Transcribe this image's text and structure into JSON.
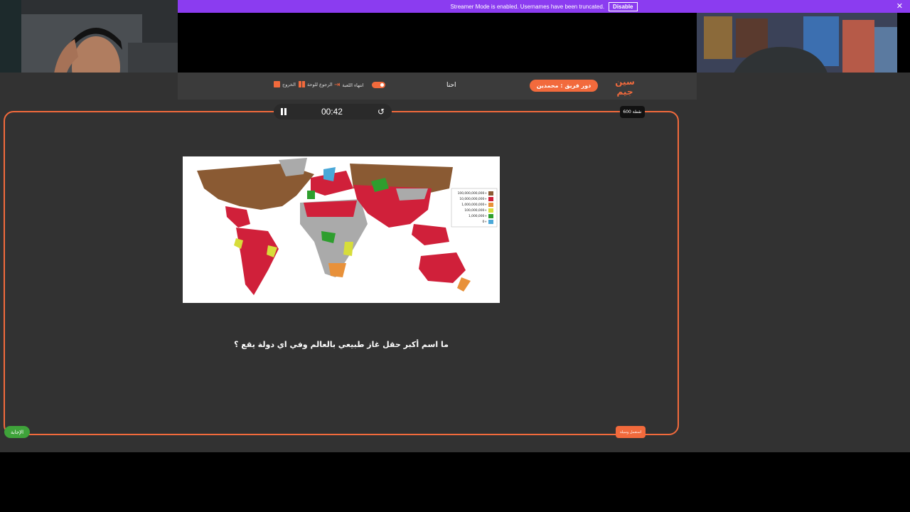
{
  "banner": {
    "text": "Streamer Mode is enabled. Usernames have been truncated.",
    "disable_label": "Disable",
    "close": "✕"
  },
  "header": {
    "logo": "سين جيم",
    "turn_pill": "دور فريق : محمدين",
    "team_name": "احنا",
    "end_game": "انتهاء اللعبة",
    "back_to_board": "الرجوع للوحة",
    "exit": "الخروج"
  },
  "timer": {
    "time": "00:42"
  },
  "points": "600 نقطة",
  "question": "ما اسم أكبر حقل غاز طبيعي بالعالم وفي اي دولة يقع ؟",
  "answer_button": "الإجابة",
  "help_button": "استعمل وسيلة",
  "map_legend": [
    "100,000,000,000+",
    "10,000,000,000+",
    "1,000,000,000+",
    "100,000,000+",
    "1,000,000+",
    "0+"
  ],
  "colors": {
    "accent": "#f26a3c",
    "banner": "#8b3cf0",
    "answer": "#3fa33a"
  }
}
